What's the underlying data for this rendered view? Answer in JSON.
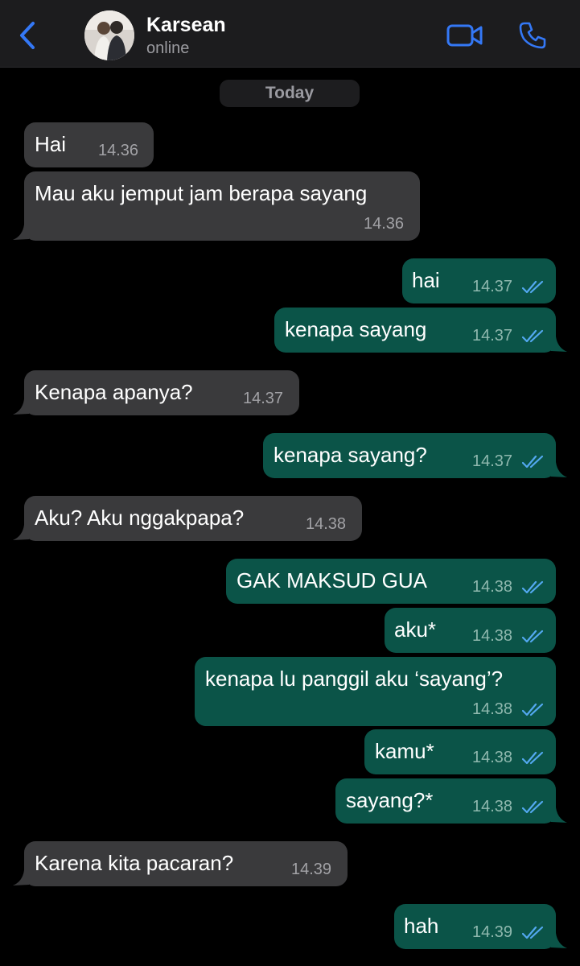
{
  "header": {
    "contact_name": "Karsean",
    "status": "online",
    "back_icon": "chevron-left-icon",
    "video_icon": "video-camera-icon",
    "call_icon": "phone-icon",
    "accent_color": "#3478f6"
  },
  "date_separator": "Today",
  "colors": {
    "incoming_bubble": "#3a3a3c",
    "outgoing_bubble": "#0b5448",
    "read_ticks": "#53a8f0"
  },
  "messages": [
    {
      "direction": "incoming",
      "text": "Hai",
      "time": "14.36"
    },
    {
      "direction": "incoming",
      "text": "Mau aku jemput jam berapa sayang",
      "time": "14.36"
    },
    {
      "direction": "outgoing",
      "text": "hai",
      "time": "14.37",
      "status": "read"
    },
    {
      "direction": "outgoing",
      "text": "kenapa sayang",
      "time": "14.37",
      "status": "read"
    },
    {
      "direction": "incoming",
      "text": "Kenapa apanya?",
      "time": "14.37"
    },
    {
      "direction": "outgoing",
      "text": "kenapa sayang?",
      "time": "14.37",
      "status": "read"
    },
    {
      "direction": "incoming",
      "text": "Aku? Aku nggakpapa?",
      "time": "14.38"
    },
    {
      "direction": "outgoing",
      "text": "GAK MAKSUD GUA",
      "time": "14.38",
      "status": "read"
    },
    {
      "direction": "outgoing",
      "text": "aku*",
      "time": "14.38",
      "status": "read"
    },
    {
      "direction": "outgoing",
      "text": "kenapa lu panggil aku ‘sayang’?",
      "time": "14.38",
      "status": "read"
    },
    {
      "direction": "outgoing",
      "text": "kamu*",
      "time": "14.38",
      "status": "read"
    },
    {
      "direction": "outgoing",
      "text": "sayang?*",
      "time": "14.38",
      "status": "read"
    },
    {
      "direction": "incoming",
      "text": "Karena kita pacaran?",
      "time": "14.39"
    },
    {
      "direction": "outgoing",
      "text": "hah",
      "time": "14.39",
      "status": "read"
    }
  ]
}
